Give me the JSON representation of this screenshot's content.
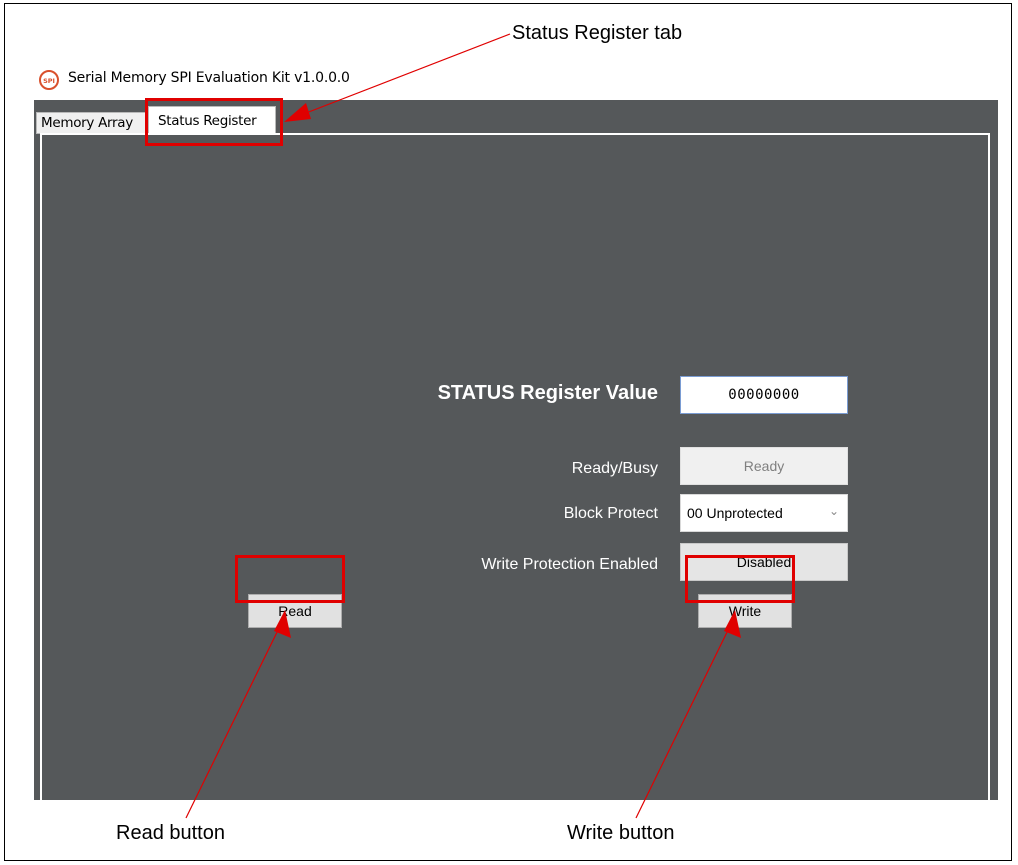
{
  "window": {
    "title": "Serial Memory SPI Evaluation Kit v1.0.0.0",
    "icon_text": "SPI"
  },
  "tabs": [
    {
      "label": "Memory Array",
      "selected": false
    },
    {
      "label": "Status Register",
      "selected": true
    }
  ],
  "status_register": {
    "value_label": "STATUS Register Value",
    "value": "00000000",
    "ready_busy_label": "Ready/Busy",
    "ready_busy_value": "Ready",
    "block_protect_label": "Block Protect",
    "block_protect_value": "00 Unprotected",
    "write_protection_label": "Write Protection Enabled",
    "write_protection_value": "Disabled",
    "read_label": "Read",
    "write_label": "Write"
  },
  "callouts": {
    "status_tab": "Status Register tab",
    "read_button": "Read button",
    "write_button": "Write button"
  },
  "colors": {
    "panel_background": "#55585a",
    "callout_red": "#e00000"
  }
}
